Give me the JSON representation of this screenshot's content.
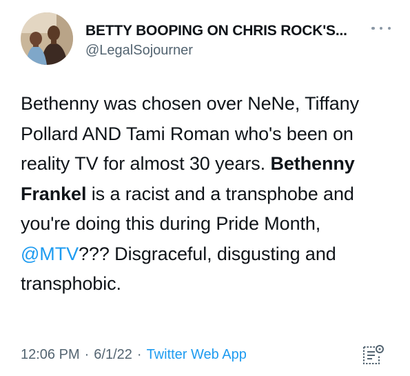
{
  "author": {
    "display_name": "BETTY BOOPING ON CHRIS ROCK'S...",
    "handle": "@LegalSojourner"
  },
  "tweet": {
    "text_part1": "Bethenny was chosen over NeNe, Tiffany Pollard AND Tami Roman who's been on reality TV for almost 30 years. ",
    "bold_text": "Bethenny Frankel",
    "text_part2": " is a racist and a transphobe and you're doing this during Pride Month, ",
    "mention": "@MTV",
    "text_part3": "??? Disgraceful, disgusting and transphobic."
  },
  "meta": {
    "time": "12:06 PM",
    "separator": "·",
    "date": "6/1/22",
    "source": "Twitter Web App"
  },
  "icons": {
    "more": "more-horizontal-icon",
    "analytics": "tweet-analytics-icon"
  },
  "colors": {
    "link": "#1d9bf0",
    "secondary_text": "#536471",
    "primary_text": "#0f1419"
  }
}
